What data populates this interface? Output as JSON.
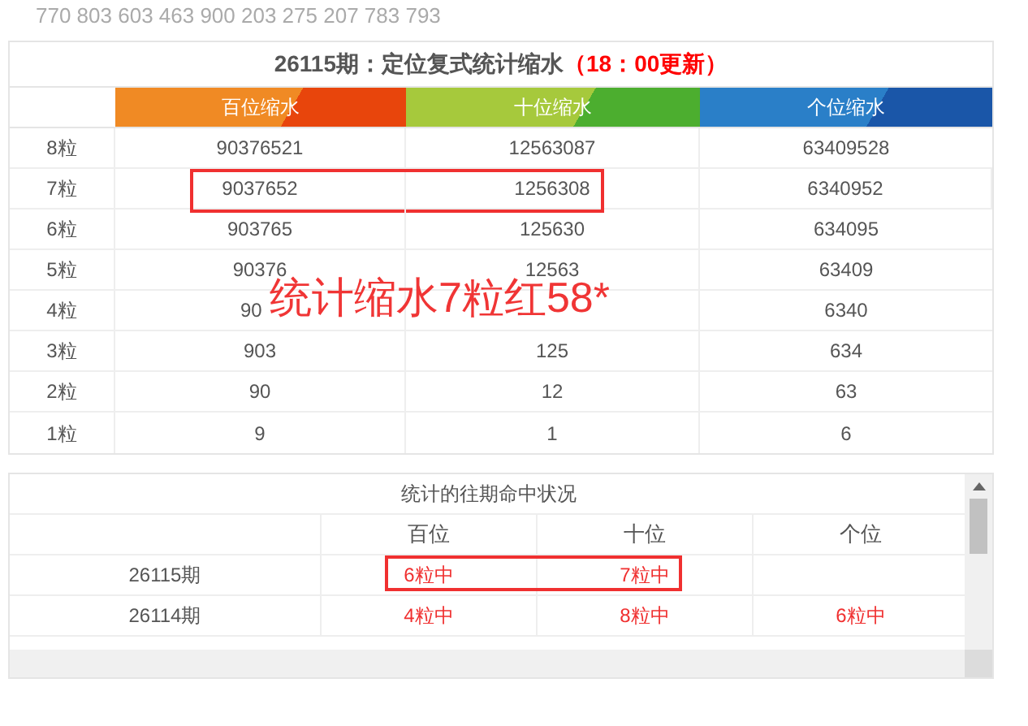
{
  "top_numbers": "770 803 603 463 900 203 275 207 783 793",
  "table": {
    "title": "26115期：定位复式统计缩水",
    "title_note": "（18：00更新）",
    "columns": [
      {
        "label": "百位缩水",
        "kind": "orange"
      },
      {
        "label": "十位缩水",
        "kind": "green"
      },
      {
        "label": "个位缩水",
        "kind": "blue"
      }
    ],
    "rows": [
      {
        "label": "8粒",
        "cells": [
          "90376521",
          "12563087",
          "63409528"
        ],
        "boxed": false
      },
      {
        "label": "7粒",
        "cells": [
          "9037652",
          "1256308",
          "6340952"
        ],
        "boxed": true
      },
      {
        "label": "6粒",
        "cells": [
          "903765",
          "125630",
          "634095"
        ],
        "boxed": false
      },
      {
        "label": "5粒",
        "cells": [
          "90376",
          "12563",
          "63409"
        ],
        "boxed": false
      },
      {
        "label": "4粒",
        "cells": [
          "90",
          null,
          "6340"
        ],
        "boxed": false
      },
      {
        "label": "3粒",
        "cells": [
          "903",
          "125",
          "634"
        ],
        "boxed": false
      },
      {
        "label": "2粒",
        "cells": [
          "90",
          "12",
          "63"
        ],
        "boxed": false
      },
      {
        "label": "1粒",
        "cells": [
          "9",
          "1",
          "6"
        ],
        "boxed": false
      }
    ]
  },
  "annotation": "统计缩水7粒红58*",
  "history": {
    "title": "统计的往期命中状况",
    "columns": [
      "百位",
      "十位",
      "个位"
    ],
    "rows": [
      {
        "period": "26115期",
        "cells": [
          "6粒中",
          "7粒中",
          null
        ],
        "boxed": true
      },
      {
        "period": "26114期",
        "cells": [
          "4粒中",
          "8粒中",
          "6粒中"
        ],
        "boxed": false
      }
    ]
  }
}
